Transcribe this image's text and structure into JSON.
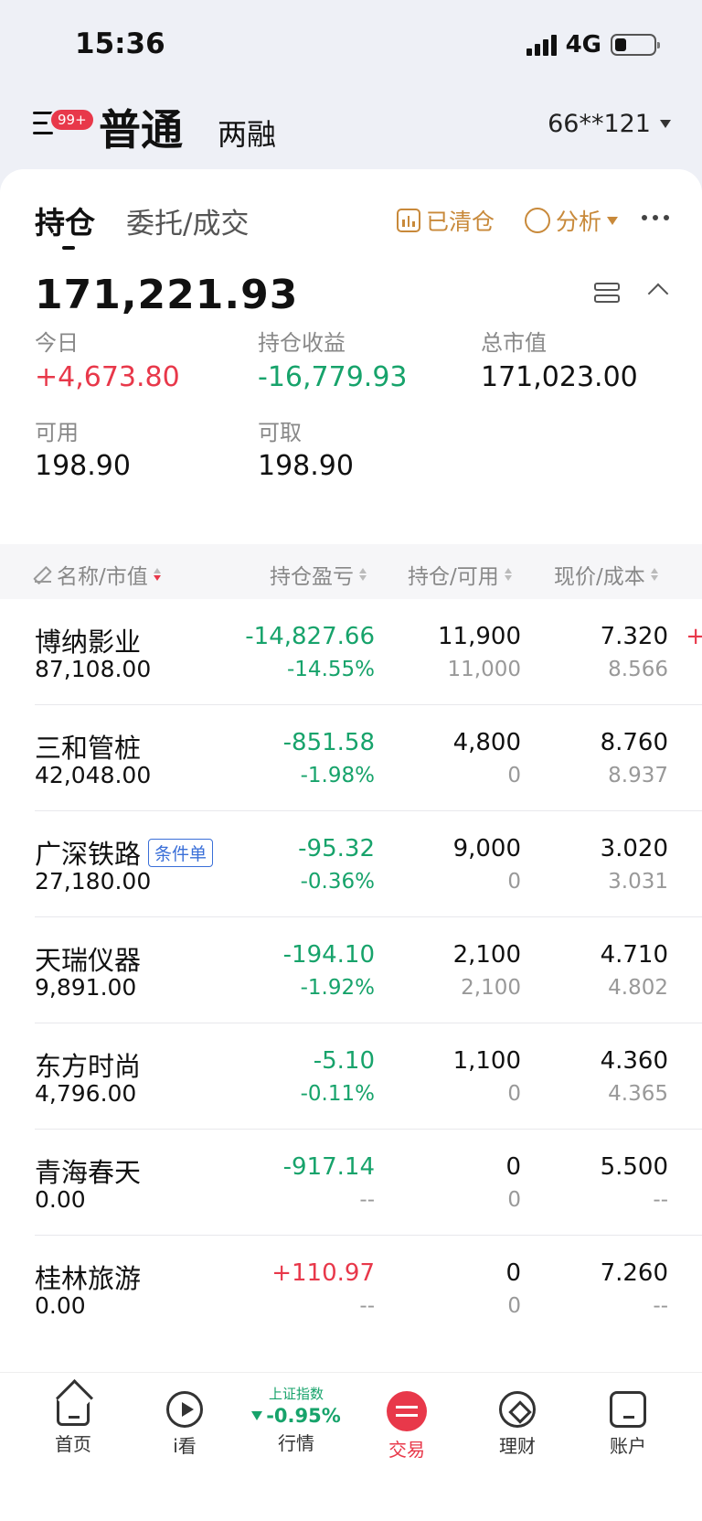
{
  "status_bar": {
    "time": "15:36",
    "network": "4G"
  },
  "header": {
    "badge": "99+",
    "mode_main": "普通",
    "mode_sub": "两融",
    "account": "66**121"
  },
  "tabs": {
    "holdings": "持仓",
    "orders": "委托/成交",
    "cleared": "已清仓",
    "analysis": "分析"
  },
  "summary": {
    "total_assets": "171,221.93",
    "today_label": "今日",
    "today_value": "+4,673.80",
    "position_pl_label": "持仓收益",
    "position_pl_value": "-16,779.93",
    "market_value_label": "总市值",
    "market_value_value": "171,023.00",
    "available_label": "可用",
    "available_value": "198.90",
    "withdrawable_label": "可取",
    "withdrawable_value": "198.90"
  },
  "table": {
    "headers": {
      "name": "名称/市值",
      "pl": "持仓盈亏",
      "hold": "持仓/可用",
      "price": "现价/成本"
    },
    "rows": [
      {
        "name": "博纳影业",
        "tag": "",
        "market_value": "87,108.00",
        "pl": "-14,827.66",
        "pl_pct": "-14.55%",
        "pl_sign": "neg",
        "hold": "11,900",
        "avail": "11,000",
        "price": "7.320",
        "cost": "8.566",
        "edge": "+"
      },
      {
        "name": "三和管桩",
        "tag": "",
        "market_value": "42,048.00",
        "pl": "-851.58",
        "pl_pct": "-1.98%",
        "pl_sign": "neg",
        "hold": "4,800",
        "avail": "0",
        "price": "8.760",
        "cost": "8.937",
        "edge": ""
      },
      {
        "name": "广深铁路",
        "tag": "条件单",
        "market_value": "27,180.00",
        "pl": "-95.32",
        "pl_pct": "-0.36%",
        "pl_sign": "neg",
        "hold": "9,000",
        "avail": "0",
        "price": "3.020",
        "cost": "3.031",
        "edge": ""
      },
      {
        "name": "天瑞仪器",
        "tag": "",
        "market_value": "9,891.00",
        "pl": "-194.10",
        "pl_pct": "-1.92%",
        "pl_sign": "neg",
        "hold": "2,100",
        "avail": "2,100",
        "price": "4.710",
        "cost": "4.802",
        "edge": ""
      },
      {
        "name": "东方时尚",
        "tag": "",
        "market_value": "4,796.00",
        "pl": "-5.10",
        "pl_pct": "-0.11%",
        "pl_sign": "neg",
        "hold": "1,100",
        "avail": "0",
        "price": "4.360",
        "cost": "4.365",
        "edge": ""
      },
      {
        "name": "青海春天",
        "tag": "",
        "market_value": "0.00",
        "pl": "-917.14",
        "pl_pct": "--",
        "pl_sign": "neg",
        "hold": "0",
        "avail": "0",
        "price": "5.500",
        "cost": "--",
        "edge": ""
      },
      {
        "name": "桂林旅游",
        "tag": "",
        "market_value": "0.00",
        "pl": "+110.97",
        "pl_pct": "--",
        "pl_sign": "pos",
        "hold": "0",
        "avail": "0",
        "price": "7.260",
        "cost": "--",
        "edge": ""
      }
    ]
  },
  "bottom_nav": {
    "home": "首页",
    "watch": "i看",
    "market_index_name": "上证指数",
    "market_index_value": "-0.95%",
    "market": "行情",
    "trade": "交易",
    "finance": "理财",
    "account": "账户"
  },
  "colors": {
    "up": "#e8384a",
    "down": "#17a36b",
    "accent": "#c8893a",
    "tag_blue": "#3a6fd8"
  }
}
